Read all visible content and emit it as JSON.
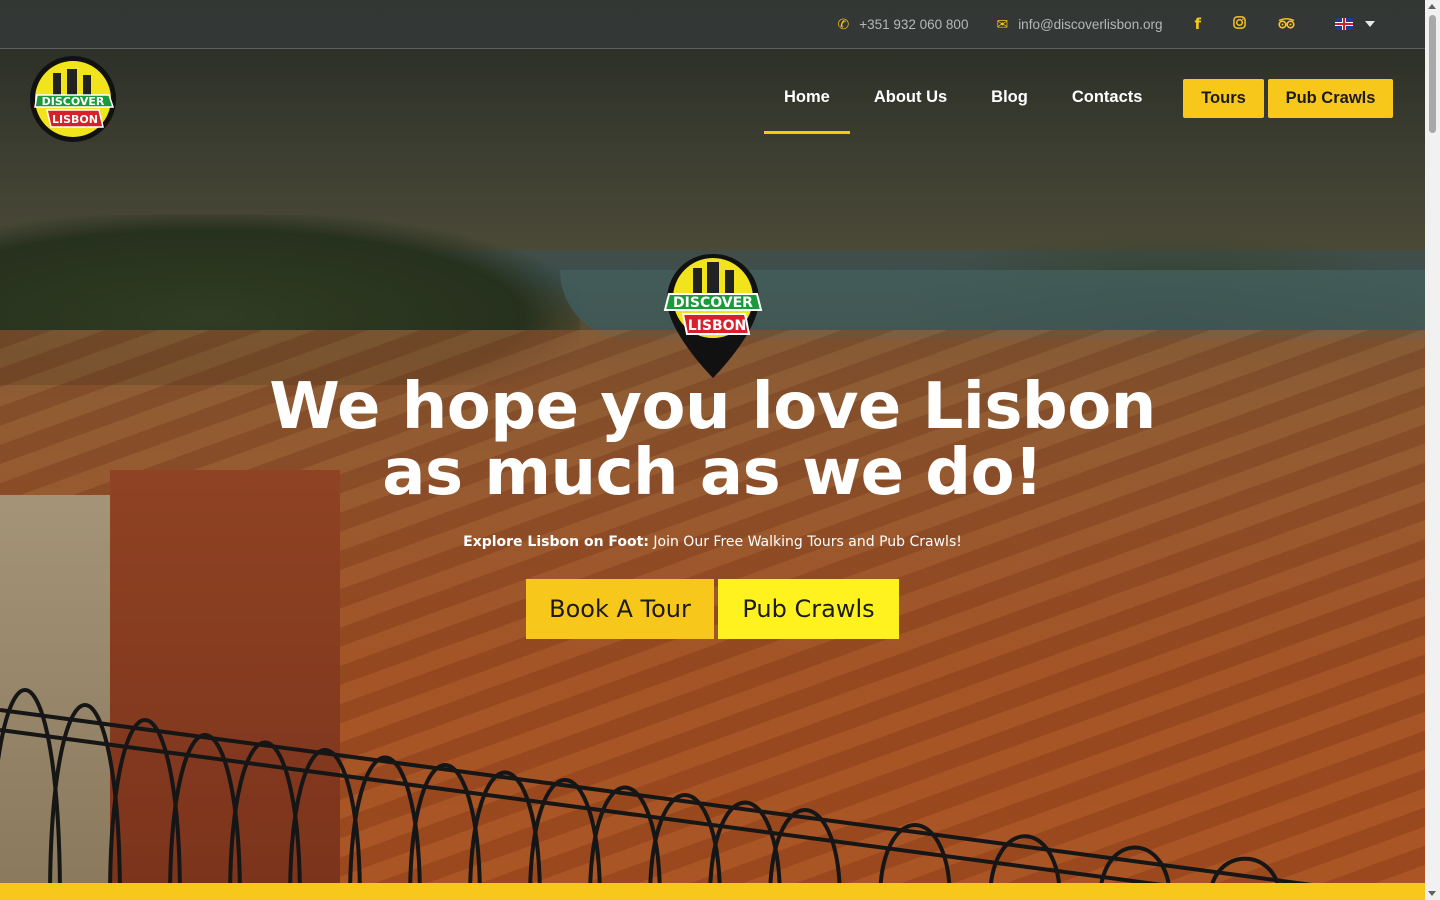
{
  "topbar": {
    "phone": "+351 932 060 800",
    "email": "info@discoverlisbon.org",
    "social": [
      "facebook-icon",
      "instagram-icon",
      "tripadvisor-icon"
    ],
    "language": "en-flag-icon"
  },
  "logo": {
    "line1": "DISCOVER",
    "line2": "LISBON"
  },
  "nav": {
    "items": [
      {
        "label": "Home",
        "active": true
      },
      {
        "label": "About Us"
      },
      {
        "label": "Blog"
      },
      {
        "label": "Contacts"
      }
    ],
    "tours_button": "Tours",
    "pubcrawls_button": "Pub Crawls"
  },
  "hero": {
    "headline_line1": "We hope you love Lisbon",
    "headline_line2": "as much as we do!",
    "sub_bold": "Explore Lisbon on Foot:",
    "sub_text": " Join Our Free Walking Tours and Pub Crawls!",
    "cta_tour": "Book A Tour",
    "cta_pub": "Pub Crawls"
  },
  "colors": {
    "accent": "#f7c71c",
    "accent_bright": "#fff21f",
    "text_dark": "#1b1b1b"
  }
}
